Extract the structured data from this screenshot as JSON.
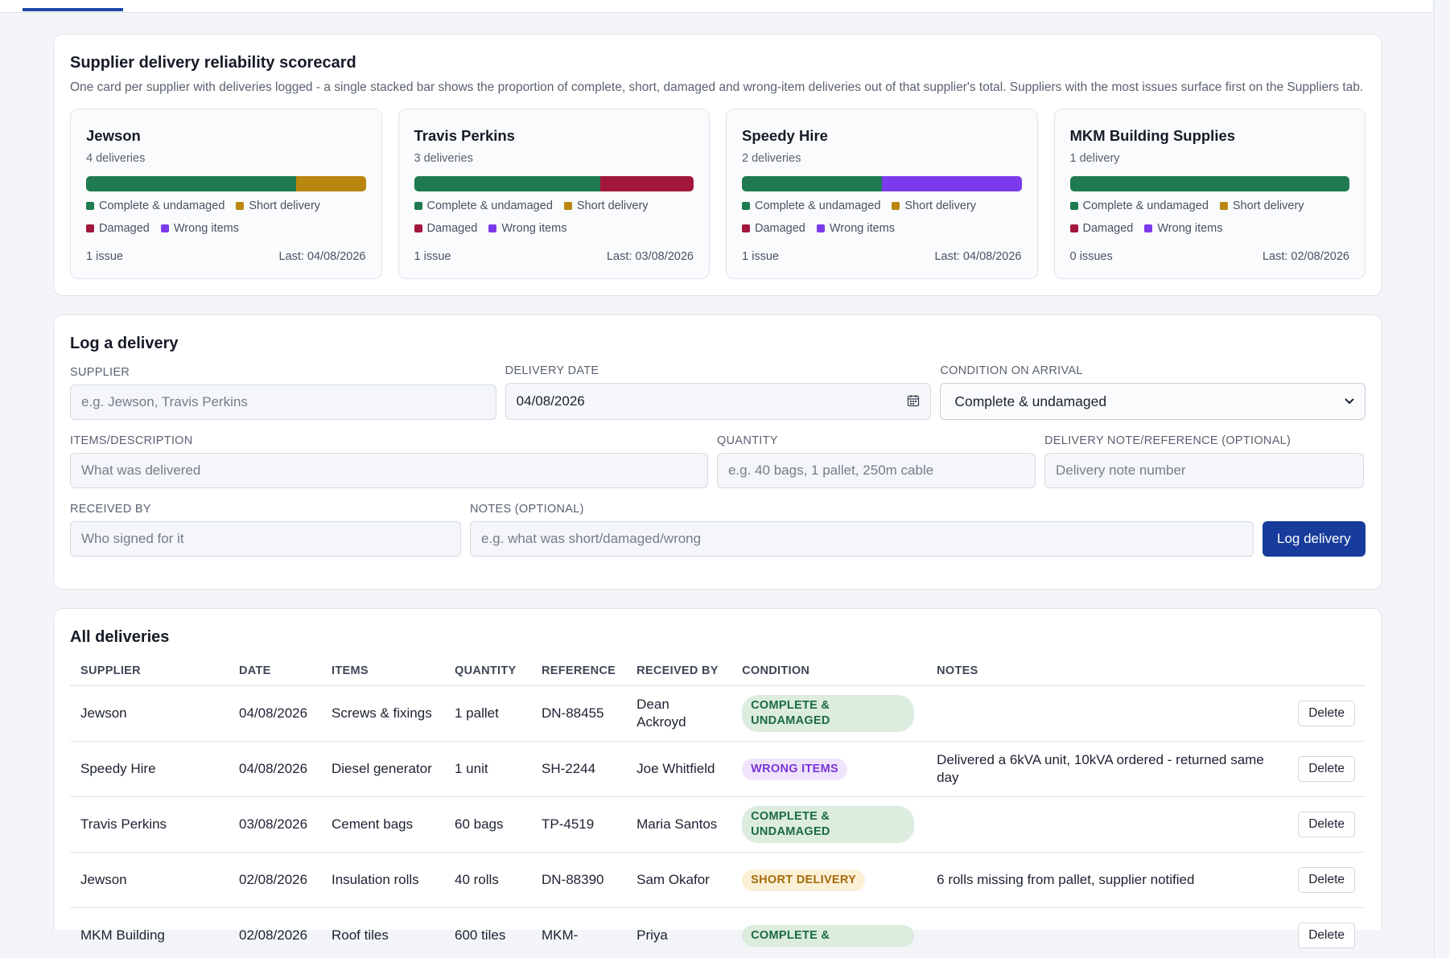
{
  "colors": {
    "complete": "#1f7a50",
    "short": "#b9860f",
    "damaged": "#a3163c",
    "wrong": "#7c3aed",
    "accent": "#183c9c"
  },
  "scorecard": {
    "title": "Supplier delivery reliability scorecard",
    "description": "One card per supplier with deliveries logged - a single stacked bar shows the proportion of complete, short, damaged and wrong-item deliveries out of that supplier's total. Suppliers with the most issues surface first on the Suppliers tab.",
    "legend": {
      "complete": "Complete & undamaged",
      "short": "Short delivery",
      "damaged": "Damaged",
      "wrong": "Wrong items"
    },
    "cards": [
      {
        "name": "Jewson",
        "count": "4 deliveries",
        "issues": "1 issue",
        "last": "Last: 04/08/2026",
        "complete": 3,
        "short": 1,
        "damaged": 0,
        "wrong": 0
      },
      {
        "name": "Travis Perkins",
        "count": "3 deliveries",
        "issues": "1 issue",
        "last": "Last: 03/08/2026",
        "complete": 2,
        "short": 0,
        "damaged": 1,
        "wrong": 0
      },
      {
        "name": "Speedy Hire",
        "count": "2 deliveries",
        "issues": "1 issue",
        "last": "Last: 04/08/2026",
        "complete": 1,
        "short": 0,
        "damaged": 0,
        "wrong": 1
      },
      {
        "name": "MKM Building Supplies",
        "count": "1 delivery",
        "issues": "0 issues",
        "last": "Last: 02/08/2026",
        "complete": 1,
        "short": 0,
        "damaged": 0,
        "wrong": 0
      }
    ]
  },
  "form": {
    "title": "Log a delivery",
    "supplier": {
      "label": "SUPPLIER",
      "placeholder": "e.g. Jewson, Travis Perkins"
    },
    "date": {
      "label": "DELIVERY DATE",
      "value": "04/08/2026"
    },
    "condition": {
      "label": "CONDITION ON ARRIVAL",
      "value": "Complete & undamaged"
    },
    "items": {
      "label": "ITEMS/DESCRIPTION",
      "placeholder": "What was delivered"
    },
    "quantity": {
      "label": "QUANTITY",
      "placeholder": "e.g. 40 bags, 1 pallet, 250m cable"
    },
    "reference": {
      "label": "DELIVERY NOTE/REFERENCE (OPTIONAL)",
      "placeholder": "Delivery note number"
    },
    "received_by": {
      "label": "RECEIVED BY",
      "placeholder": "Who signed for it"
    },
    "notes": {
      "label": "NOTES (OPTIONAL)",
      "placeholder": "e.g. what was short/damaged/wrong"
    },
    "submit_label": "Log delivery"
  },
  "deliveries": {
    "title": "All deliveries",
    "columns": [
      "SUPPLIER",
      "DATE",
      "ITEMS",
      "QUANTITY",
      "REFERENCE",
      "RECEIVED BY",
      "CONDITION",
      "NOTES"
    ],
    "delete_label": "Delete",
    "rows": [
      {
        "supplier": "Jewson",
        "date": "04/08/2026",
        "items": "Screws & fixings",
        "quantity": "1 pallet",
        "reference": "DN-88455",
        "received_by": "Dean Ackroyd",
        "condition": "COMPLETE & UNDAMAGED",
        "condition_type": "complete",
        "notes": ""
      },
      {
        "supplier": "Speedy Hire",
        "date": "04/08/2026",
        "items": "Diesel generator",
        "quantity": "1 unit",
        "reference": "SH-2244",
        "received_by": "Joe Whitfield",
        "condition": "WRONG ITEMS",
        "condition_type": "wrong",
        "notes": "Delivered a 6kVA unit, 10kVA ordered - returned same day"
      },
      {
        "supplier": "Travis Perkins",
        "date": "03/08/2026",
        "items": "Cement bags",
        "quantity": "60 bags",
        "reference": "TP-4519",
        "received_by": "Maria Santos",
        "condition": "COMPLETE & UNDAMAGED",
        "condition_type": "complete",
        "notes": ""
      },
      {
        "supplier": "Jewson",
        "date": "02/08/2026",
        "items": "Insulation rolls",
        "quantity": "40 rolls",
        "reference": "DN-88390",
        "received_by": "Sam Okafor",
        "condition": "SHORT DELIVERY",
        "condition_type": "short",
        "notes": "6 rolls missing from pallet, supplier notified"
      },
      {
        "supplier": "MKM Building",
        "date": "02/08/2026",
        "items": "Roof tiles",
        "quantity": "600 tiles",
        "reference": "MKM-",
        "received_by": "Priya",
        "condition": "COMPLETE &",
        "condition_type": "complete",
        "notes": ""
      }
    ]
  }
}
